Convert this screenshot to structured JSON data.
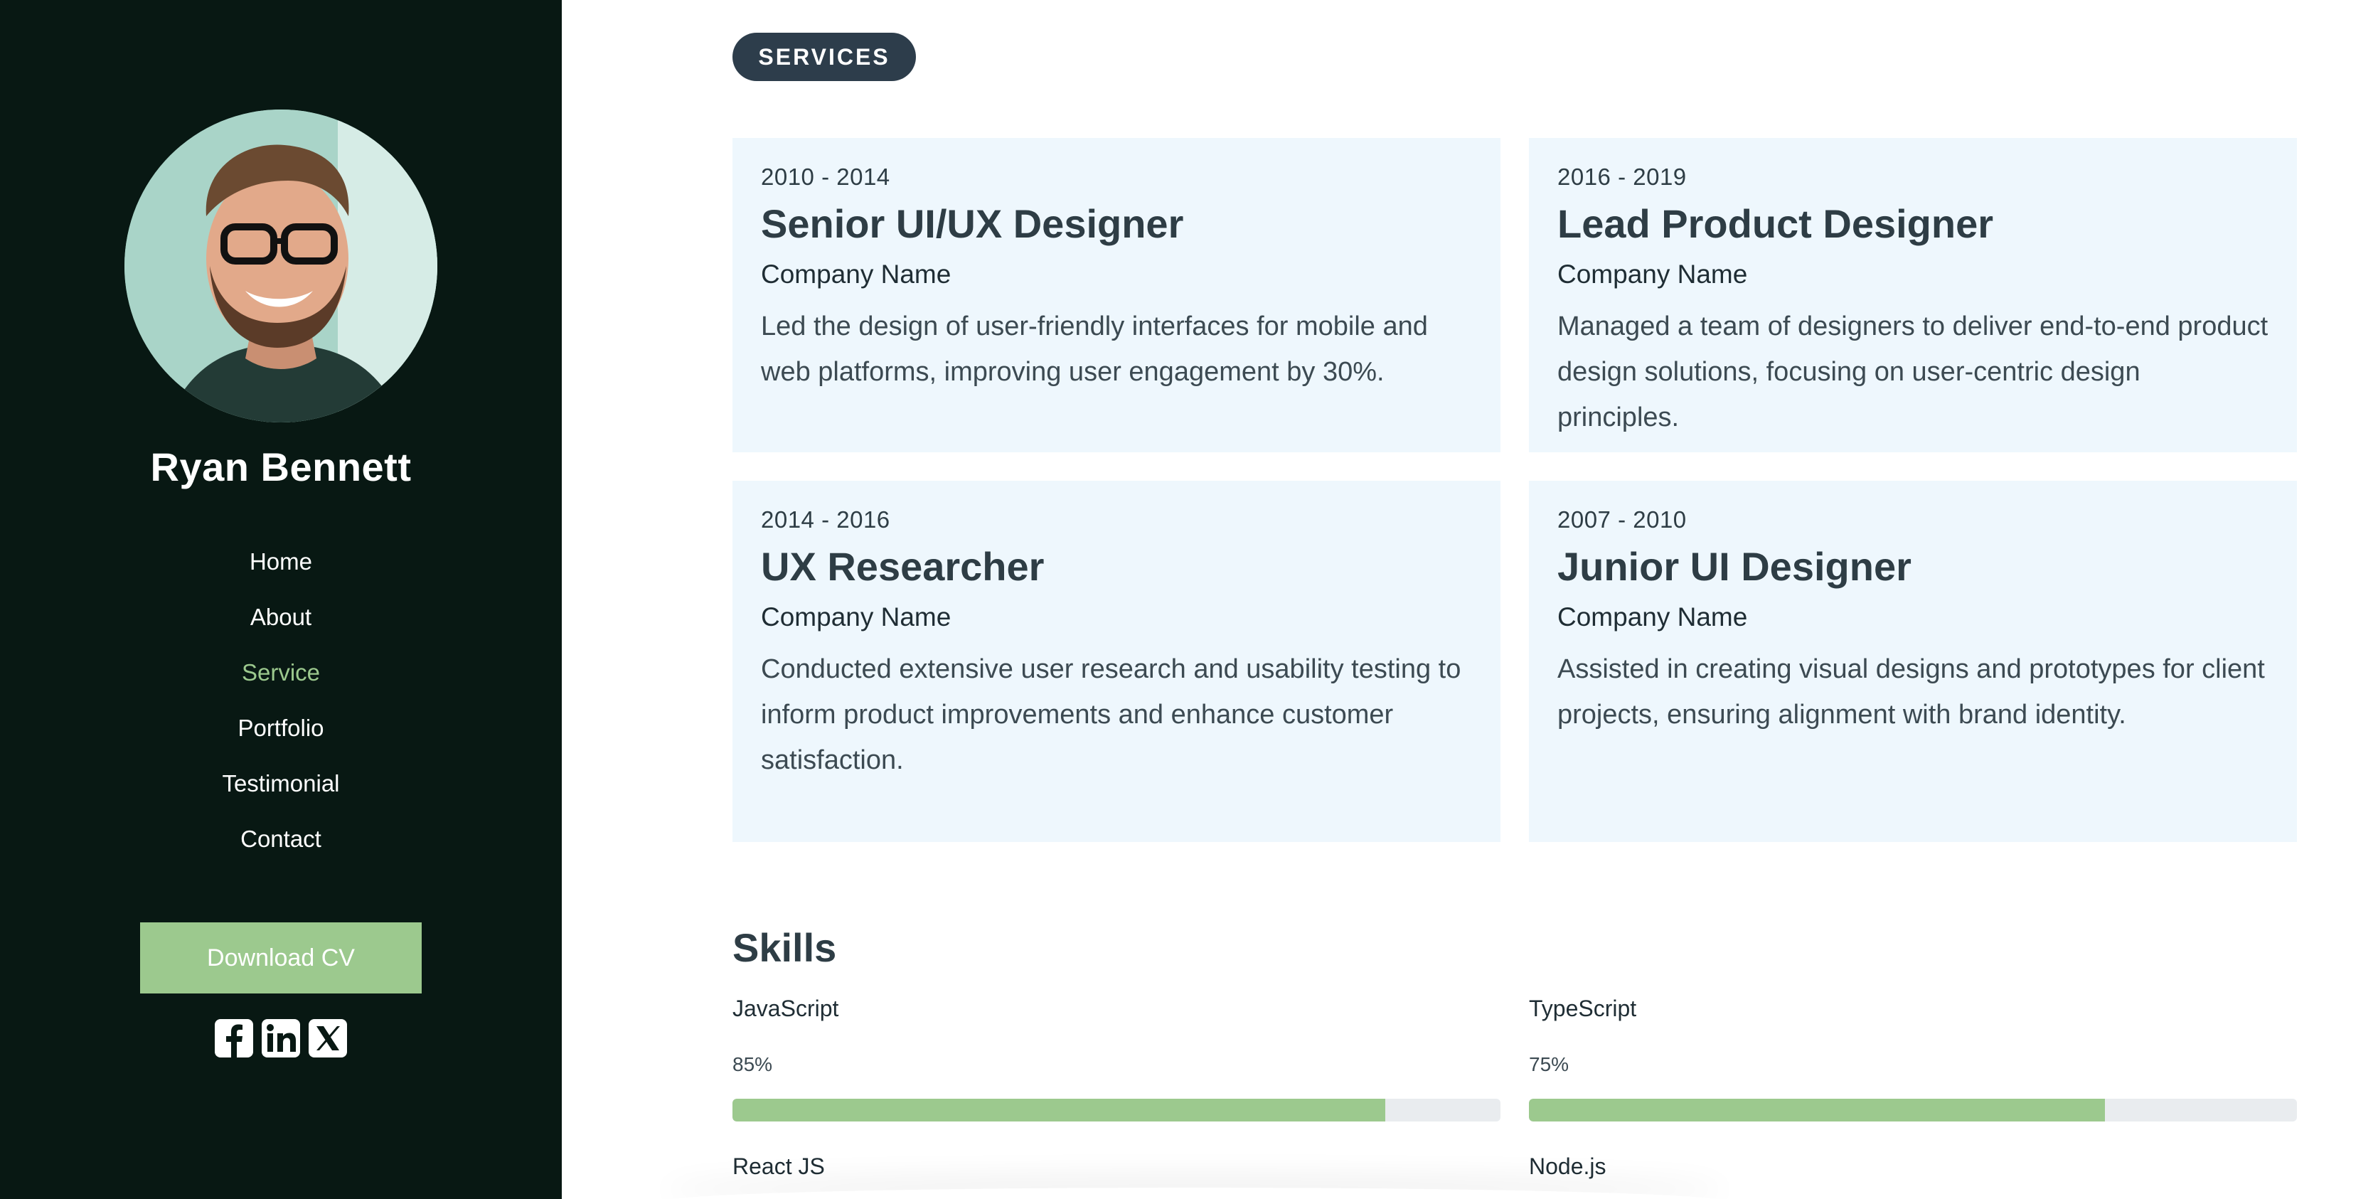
{
  "profile": {
    "name": "Ryan Bennett"
  },
  "nav": {
    "items": [
      {
        "label": "Home",
        "active": false
      },
      {
        "label": "About",
        "active": false
      },
      {
        "label": "Service",
        "active": true
      },
      {
        "label": "Portfolio",
        "active": false
      },
      {
        "label": "Testimonial",
        "active": false
      },
      {
        "label": "Contact",
        "active": false
      }
    ]
  },
  "sidebar": {
    "download_label": "Download CV",
    "socials": [
      "facebook-icon",
      "linkedin-icon",
      "x-icon"
    ]
  },
  "section": {
    "badge": "SERVICES"
  },
  "experience": [
    {
      "date": "2010 - 2014",
      "title": "Senior UI/UX Designer",
      "company": "Company Name",
      "description": "Led the design of user-friendly interfaces for mobile and web platforms, improving user engagement by 30%."
    },
    {
      "date": "2016 - 2019",
      "title": "Lead Product Designer",
      "company": "Company Name",
      "description": "Managed a team of designers to deliver end-to-end product design solutions, focusing on user-centric design principles."
    },
    {
      "date": "2014 - 2016",
      "title": "UX Researcher",
      "company": "Company Name",
      "description": "Conducted extensive user research and usability testing to inform product improvements and enhance customer satisfaction."
    },
    {
      "date": "2007 - 2010",
      "title": "Junior UI Designer",
      "company": "Company Name",
      "description": "Assisted in creating visual designs and prototypes for client projects, ensuring alignment with brand identity."
    }
  ],
  "skills": {
    "title": "Skills",
    "items": [
      {
        "name": "JavaScript",
        "percent_label": "85%",
        "level": 0.85
      },
      {
        "name": "TypeScript",
        "percent_label": "75%",
        "level": 0.75
      },
      {
        "name": "React JS"
      },
      {
        "name": "Node.js"
      }
    ]
  },
  "colors": {
    "sidebar_bg": "#081813",
    "accent": "#9cc98e",
    "badge_bg": "#2d3d4b",
    "card_bg": "#eef7fd",
    "text": "#2e3d45"
  }
}
